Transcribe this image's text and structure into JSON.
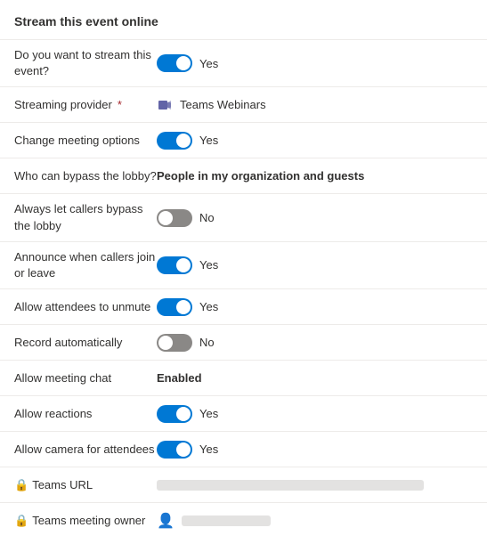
{
  "title": "Stream this event online",
  "rows": [
    {
      "id": "stream-event",
      "label": "Do you want to stream this event?",
      "type": "toggle",
      "toggleState": "on",
      "toggleLabel": "Yes"
    },
    {
      "id": "streaming-provider",
      "label": "Streaming provider",
      "required": true,
      "type": "provider",
      "providerName": "Teams Webinars"
    },
    {
      "id": "change-meeting-options",
      "label": "Change meeting options",
      "type": "toggle",
      "toggleState": "on",
      "toggleLabel": "Yes"
    },
    {
      "id": "bypass-lobby",
      "label": "Who can bypass the lobby?",
      "type": "text",
      "value": "People in my organization and guests"
    },
    {
      "id": "callers-bypass-lobby",
      "label": "Always let callers bypass the lobby",
      "type": "toggle",
      "toggleState": "off",
      "toggleLabel": "No"
    },
    {
      "id": "announce-callers",
      "label": "Announce when callers join or leave",
      "type": "toggle",
      "toggleState": "on",
      "toggleLabel": "Yes"
    },
    {
      "id": "allow-unmute",
      "label": "Allow attendees to unmute",
      "type": "toggle",
      "toggleState": "on",
      "toggleLabel": "Yes"
    },
    {
      "id": "record-automatically",
      "label": "Record automatically",
      "type": "toggle",
      "toggleState": "off",
      "toggleLabel": "No"
    },
    {
      "id": "allow-meeting-chat",
      "label": "Allow meeting chat",
      "type": "text",
      "value": "Enabled",
      "bold": true
    },
    {
      "id": "allow-reactions",
      "label": "Allow reactions",
      "type": "toggle",
      "toggleState": "on",
      "toggleLabel": "Yes"
    },
    {
      "id": "allow-camera",
      "label": "Allow camera for attendees",
      "type": "toggle",
      "toggleState": "on",
      "toggleLabel": "Yes"
    },
    {
      "id": "teams-url",
      "label": "Teams URL",
      "type": "url",
      "locked": true
    },
    {
      "id": "teams-owner",
      "label": "Teams meeting owner",
      "type": "person",
      "locked": true
    }
  ]
}
